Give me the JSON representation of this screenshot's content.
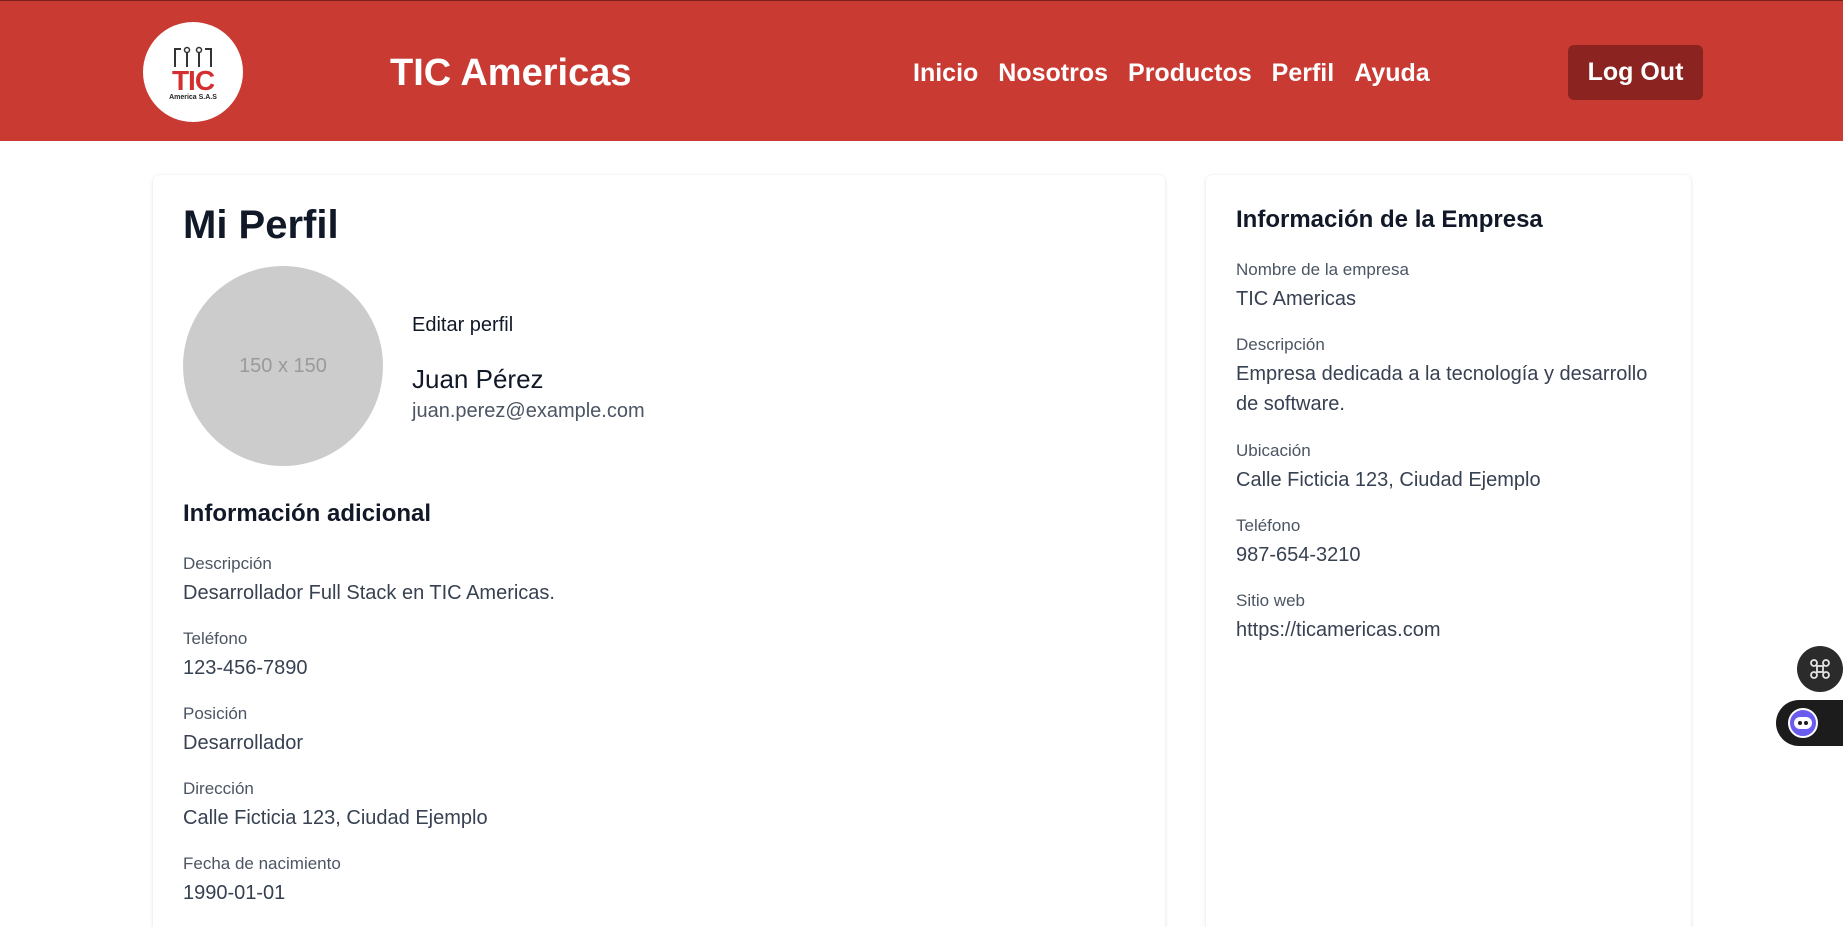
{
  "header": {
    "logo_text": "TIC",
    "logo_subtext": "America S.A.S",
    "brand": "TIC Americas",
    "nav": [
      "Inicio",
      "Nosotros",
      "Productos",
      "Perfil",
      "Ayuda"
    ],
    "logout_label": "Log Out",
    "colors": {
      "bar": "#c93a33",
      "logout": "#8b2420"
    }
  },
  "profile": {
    "title": "Mi Perfil",
    "avatar_placeholder": "150 x 150",
    "edit_label": "Editar perfil",
    "name": "Juan Pérez",
    "email": "juan.perez@example.com",
    "section_title": "Información adicional",
    "fields": [
      {
        "label": "Descripción",
        "value": "Desarrollador Full Stack en TIC Americas."
      },
      {
        "label": "Teléfono",
        "value": "123-456-7890"
      },
      {
        "label": "Posición",
        "value": "Desarrollador"
      },
      {
        "label": "Dirección",
        "value": "Calle Ficticia 123, Ciudad Ejemplo"
      },
      {
        "label": "Fecha de nacimiento",
        "value": "1990-01-01"
      }
    ]
  },
  "company": {
    "title": "Información de la Empresa",
    "fields": [
      {
        "label": "Nombre de la empresa",
        "value": "TIC Americas"
      },
      {
        "label": "Descripción",
        "value_line1": "Empresa dedicada a la tecnología y desarrollo",
        "value_line2": "de software."
      },
      {
        "label": "Ubicación",
        "value": "Calle Ficticia 123, Ciudad Ejemplo"
      },
      {
        "label": "Teléfono",
        "value": "987-654-3210"
      },
      {
        "label": "Sitio web",
        "value": "https://ticamericas.com"
      }
    ]
  },
  "widgets": {
    "shortcut_icon": "command-icon",
    "assistant_icon": "assistant-bot-icon"
  }
}
